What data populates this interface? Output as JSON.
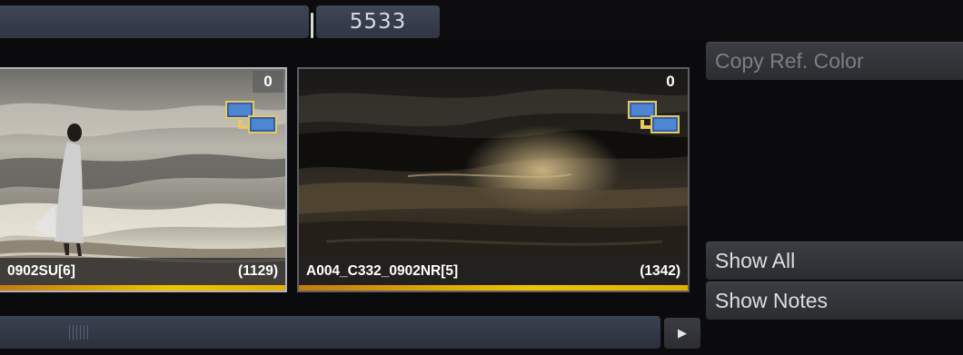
{
  "header": {
    "frame_number": "5533"
  },
  "thumbnails": [
    {
      "clip_name": "0902SU[6]",
      "frame_count": "(1129)",
      "version_badge": "0",
      "icon": "reference-compare-icon"
    },
    {
      "clip_name": "A004_C332_0902NR[5]",
      "frame_count": "(1342)",
      "version_badge": "0",
      "icon": "reference-compare-icon"
    }
  ],
  "side_panel": {
    "copy_ref_color_label": "Copy Ref. Color",
    "show_all_label": "Show All",
    "show_notes_label": "Show Notes"
  },
  "scrollbar": {
    "arrow_icon": "play-right-icon"
  },
  "colors": {
    "accent_progress": "#f0c400",
    "field_bg": "#3a4150",
    "button_bg": "#323438"
  }
}
